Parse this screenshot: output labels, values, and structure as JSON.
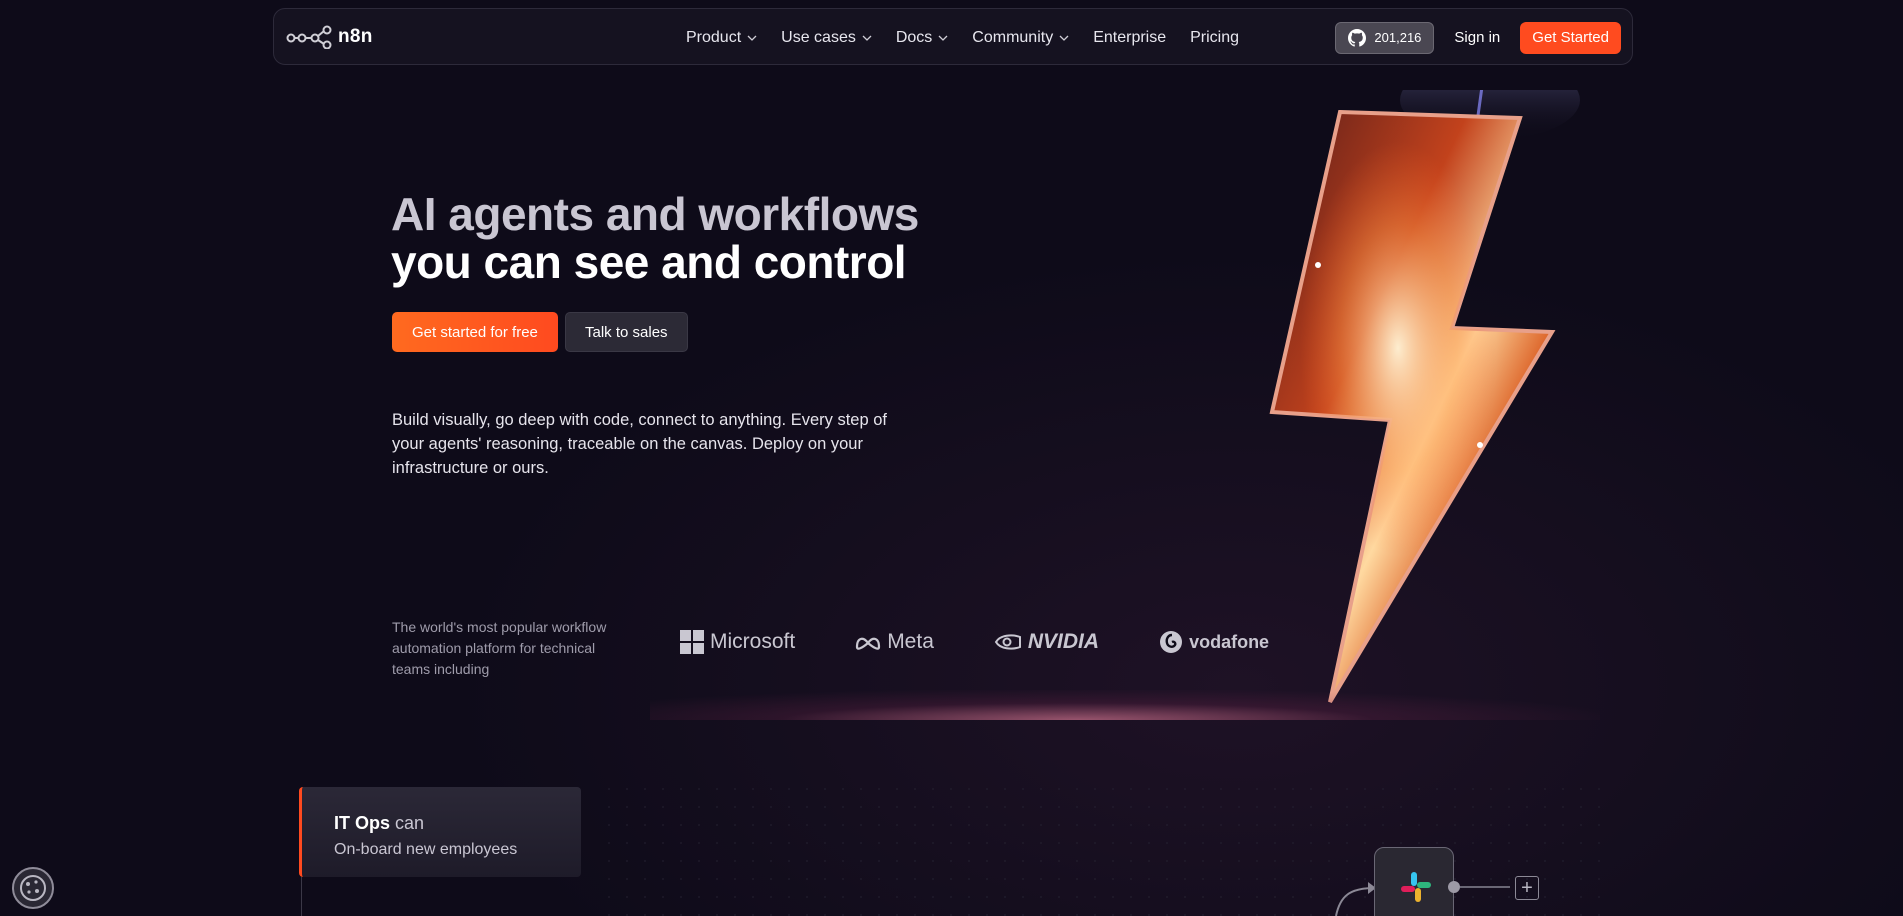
{
  "nav": {
    "brand": "n8n",
    "links": [
      {
        "label": "Product",
        "dropdown": true
      },
      {
        "label": "Use cases",
        "dropdown": true
      },
      {
        "label": "Docs",
        "dropdown": true
      },
      {
        "label": "Community",
        "dropdown": true
      },
      {
        "label": "Enterprise",
        "dropdown": false
      },
      {
        "label": "Pricing",
        "dropdown": false
      }
    ],
    "github_stars": "201,216",
    "signin": "Sign in",
    "cta": "Get Started"
  },
  "hero": {
    "title_line1": "AI agents and workflows",
    "title_line2": "you can see and control",
    "primary_cta": "Get started for free",
    "secondary_cta": "Talk to sales",
    "description": "Build visually, go deep with code, connect to anything. Every step of your agents' reasoning, traceable on the canvas. Deploy on your infrastructure or ours."
  },
  "trusted": {
    "text": "The world's most popular workflow automation platform for technical teams including",
    "brands": [
      "Microsoft",
      "Meta",
      "NVIDIA",
      "vodafone"
    ]
  },
  "usecase": {
    "team": "IT Ops",
    "can": "can",
    "task": "On-board new employees"
  },
  "colors": {
    "background": "#0e0b19",
    "accent": "#ff4b1f"
  },
  "icons": {
    "logo": "n8n-logo-icon",
    "github": "github-icon",
    "chevron": "chevron-down-icon",
    "cookie": "cookie-icon",
    "slack": "slack-icon",
    "plus": "plus-icon"
  }
}
